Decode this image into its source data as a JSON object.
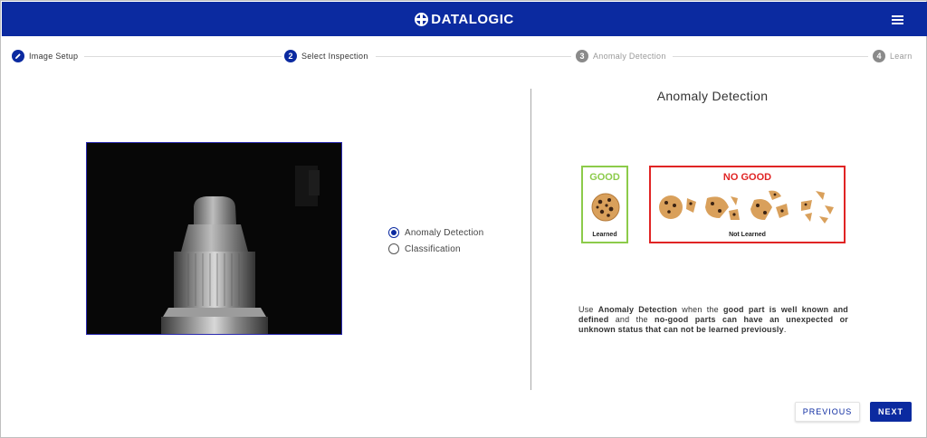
{
  "header": {
    "brand": "DATALOGIC",
    "brand_color": "#0b2aa0",
    "menu_icon": "hamburger-menu-icon"
  },
  "stepper": {
    "steps": [
      {
        "number": "",
        "icon": "pencil-icon",
        "label": "Image Setup",
        "state": "completed"
      },
      {
        "number": "2",
        "label": "Select Inspection",
        "state": "active"
      },
      {
        "number": "3",
        "label": "Anomaly Detection",
        "state": "inactive"
      },
      {
        "number": "4",
        "label": "Learn",
        "state": "inactive"
      }
    ]
  },
  "inspection_options": {
    "options": [
      {
        "label": "Anomaly Detection",
        "selected": true
      },
      {
        "label": "Classification",
        "selected": false
      }
    ]
  },
  "info_panel": {
    "title": "Anomaly Detection",
    "good_label": "GOOD",
    "good_caption": "Learned",
    "good_color": "#8ccb4a",
    "no_good_label": "NO GOOD",
    "no_good_caption": "Not Learned",
    "no_good_color": "#e02424",
    "description": {
      "p1": "Use ",
      "b1": "Anomaly Detection",
      "p2": " when the ",
      "b2": "good part is well known and defined",
      "p3": " and the ",
      "b3": "no-good parts can have an unexpected or unknown status that can",
      "p4": " ",
      "b4": "not be learned previously",
      "p5": "."
    }
  },
  "footer": {
    "previous_label": "PREVIOUS",
    "next_label": "NEXT"
  }
}
